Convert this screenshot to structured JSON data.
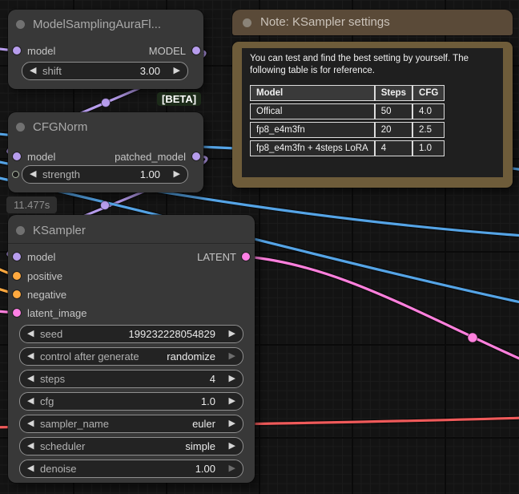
{
  "colors": {
    "wire_model_purple": "#b79ded",
    "wire_conditioning_orange": "#ffa93f",
    "wire_latent_pink": "#ff80dd",
    "wire_blue": "#55a4e6",
    "wire_red": "#ef5a5a",
    "node_background": "#383838",
    "note_header_brown": "#5a4a38",
    "note_body_tan": "#6e5c3a",
    "beta_badge_green": "#1c2b19"
  },
  "icons": {
    "decrement_arrow": "◀",
    "increment_arrow": "▶"
  },
  "badges": {
    "execution_time": "11.477s",
    "beta_label": "[BETA]"
  },
  "nodes": {
    "model_sampling": {
      "title": "ModelSamplingAuraFl...",
      "inputs": [
        {
          "name": "model"
        }
      ],
      "outputs": [
        {
          "name": "MODEL"
        }
      ],
      "widgets": [
        {
          "label": "shift",
          "value": "3.00"
        }
      ]
    },
    "cfg_norm": {
      "title": "CFGNorm",
      "inputs": [
        {
          "name": "model"
        }
      ],
      "outputs": [
        {
          "name": "patched_model"
        }
      ],
      "widgets": [
        {
          "label": "strength",
          "value": "1.00"
        }
      ]
    },
    "ksampler": {
      "title": "KSampler",
      "inputs": [
        {
          "name": "model"
        },
        {
          "name": "positive"
        },
        {
          "name": "negative"
        },
        {
          "name": "latent_image"
        }
      ],
      "outputs": [
        {
          "name": "LATENT"
        }
      ],
      "widgets": [
        {
          "label": "seed",
          "value": "199232228054829"
        },
        {
          "label": "control after generate",
          "value": "randomize"
        },
        {
          "label": "steps",
          "value": "4"
        },
        {
          "label": "cfg",
          "value": "1.0"
        },
        {
          "label": "sampler_name",
          "value": "euler"
        },
        {
          "label": "scheduler",
          "value": "simple"
        },
        {
          "label": "denoise",
          "value": "1.00"
        }
      ]
    },
    "note": {
      "title": "Note: KSampler settings",
      "body_text": "You can test and find the best setting by yourself. The following table is for reference.",
      "table": {
        "headers": [
          "Model",
          "Steps",
          "CFG"
        ],
        "rows": [
          [
            "Offical",
            "50",
            "4.0"
          ],
          [
            "fp8_e4m3fn",
            "20",
            "2.5"
          ],
          [
            "fp8_e4m3fn + 4steps LoRA",
            "4",
            "1.0"
          ]
        ]
      }
    }
  }
}
